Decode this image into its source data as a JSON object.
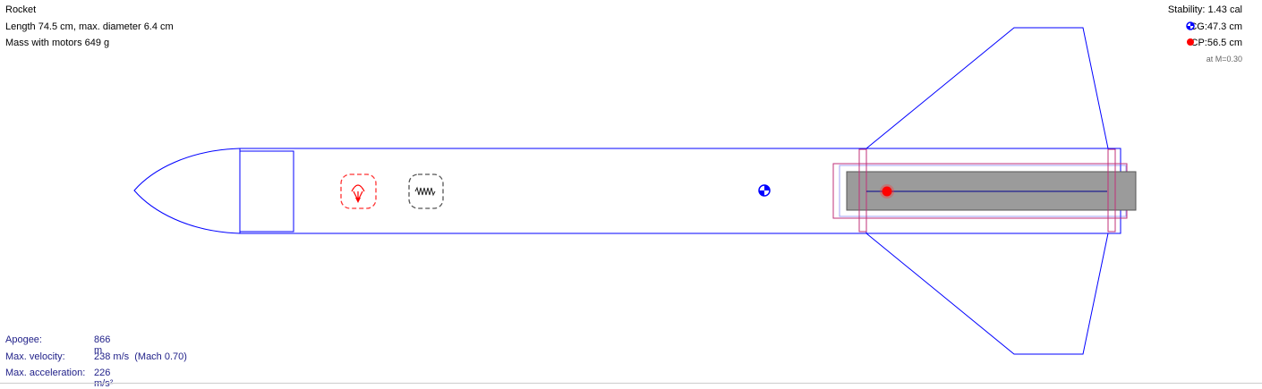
{
  "info": {
    "name": "Rocket",
    "dimensions": "Length 74.5 cm, max. diameter 6.4 cm",
    "mass": "Mass with motors 649 g"
  },
  "stability": {
    "label": "Stability: 1.43 cal",
    "cg": "CG:47.3 cm",
    "cp": "CP:56.5 cm",
    "mach": "at M=0.30"
  },
  "flight": [
    {
      "label": "Apogee:",
      "value": "866 m"
    },
    {
      "label": "Max. velocity:",
      "value": "238 m/s  (Mach 0.70)"
    },
    {
      "label": "Max. acceleration:",
      "value": "226 m/s²"
    }
  ],
  "colors": {
    "structure": "#0000ff",
    "inner": "#c0307a",
    "motor": "#9b9b9b",
    "cp": "#ff0000"
  }
}
